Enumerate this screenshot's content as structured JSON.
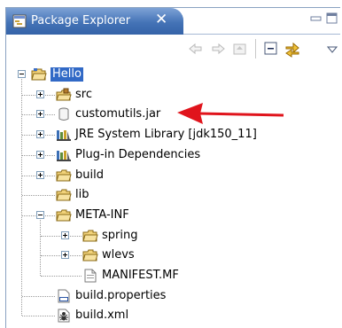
{
  "view": {
    "title": "Package Explorer",
    "close_glyph": "✕",
    "icons": {
      "view_icon": "package-explorer-icon",
      "minimize": "minimize-icon",
      "maximize": "maximize-icon"
    }
  },
  "toolbar": {
    "items": [
      {
        "name": "back-arrow-icon",
        "enabled": false
      },
      {
        "name": "forward-arrow-icon",
        "enabled": false
      },
      {
        "name": "go-up-icon",
        "enabled": false
      },
      {
        "name": "collapse-all-icon",
        "enabled": true
      },
      {
        "name": "link-with-editor-icon",
        "enabled": true
      },
      {
        "name": "view-menu-icon",
        "enabled": true
      }
    ]
  },
  "tree": {
    "nodes": [
      {
        "label": "Hello",
        "icon": "project-folder-icon",
        "expander": "minus",
        "depth": 0,
        "selected": true
      },
      {
        "label": "src",
        "icon": "source-folder-icon",
        "expander": "plus",
        "depth": 1
      },
      {
        "label": "customutils.jar",
        "icon": "jar-icon",
        "expander": "plus",
        "depth": 1
      },
      {
        "label": "JRE System Library [jdk150_11]",
        "icon": "library-icon",
        "expander": "plus",
        "depth": 1
      },
      {
        "label": "Plug-in Dependencies",
        "icon": "library-icon",
        "expander": "plus",
        "depth": 1
      },
      {
        "label": "build",
        "icon": "folder-icon",
        "expander": "plus",
        "depth": 1
      },
      {
        "label": "lib",
        "icon": "folder-icon",
        "expander": "none",
        "depth": 1
      },
      {
        "label": "META-INF",
        "icon": "folder-icon",
        "expander": "minus",
        "depth": 1
      },
      {
        "label": "spring",
        "icon": "folder-icon",
        "expander": "plus",
        "depth": 2
      },
      {
        "label": "wlevs",
        "icon": "folder-icon",
        "expander": "plus",
        "depth": 2
      },
      {
        "label": "MANIFEST.MF",
        "icon": "text-file-icon",
        "expander": "none",
        "depth": 2
      },
      {
        "label": "build.properties",
        "icon": "properties-file-icon",
        "expander": "none",
        "depth": 1
      },
      {
        "label": "build.xml",
        "icon": "ant-build-file-icon",
        "expander": "none",
        "depth": 1
      }
    ]
  },
  "annotation": {
    "type": "arrow",
    "color": "#e0141c",
    "points_to": "customutils.jar"
  }
}
